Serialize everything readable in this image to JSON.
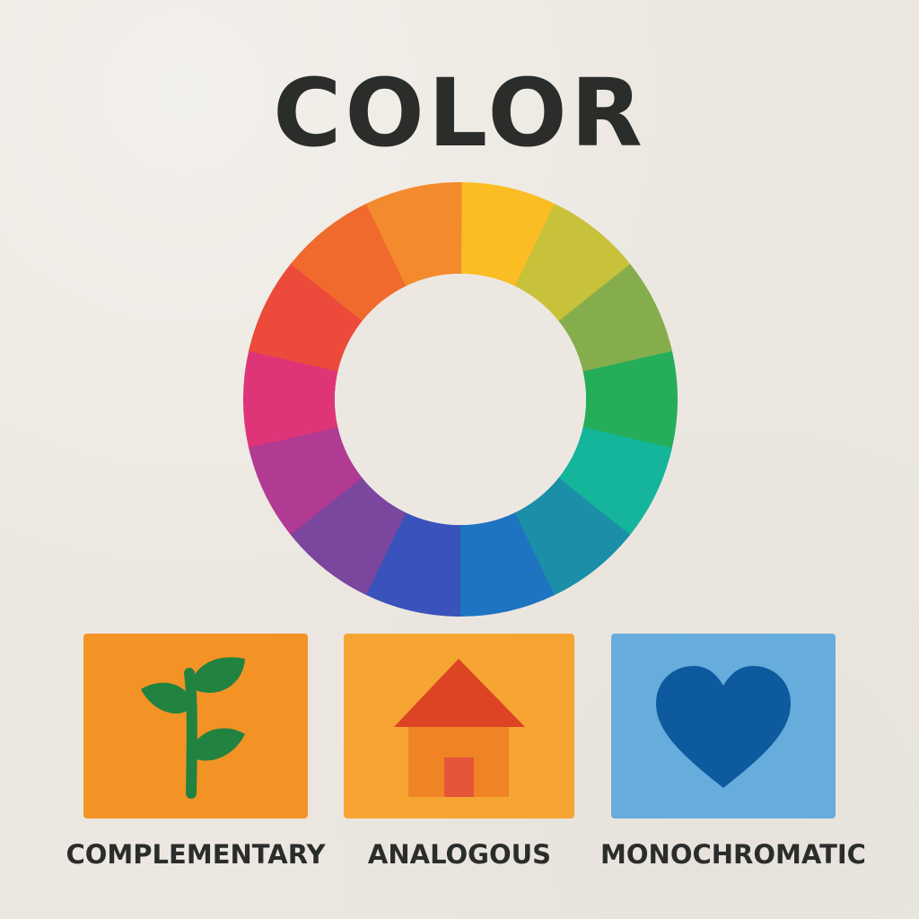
{
  "title": "COLOR",
  "wheel": {
    "segment_colors": [
      "#fbbd24",
      "#c8c13a",
      "#86ad4c",
      "#25ad5a",
      "#14b59a",
      "#1b8fa8",
      "#1e74c1",
      "#3a52bb",
      "#7b469d",
      "#b13a92",
      "#de3579",
      "#ec4a3b",
      "#f06a2e",
      "#f38b2e"
    ],
    "hole_color": "#ece8e1"
  },
  "cards": [
    {
      "label": "COMPLEMENTARY",
      "icon": "plant-sprout-icon",
      "background": "#f39325",
      "icon_color": "#22823f"
    },
    {
      "label": "ANALOGOUS",
      "icon": "house-icon",
      "background": "#f6a532",
      "roof_color": "#dc4424",
      "wall_color": "#f08326",
      "door_color": "#e4553a"
    },
    {
      "label": "MONOCHROMATIC",
      "icon": "heart-icon",
      "background": "#66acdc",
      "icon_color": "#0e5a9e"
    }
  ]
}
